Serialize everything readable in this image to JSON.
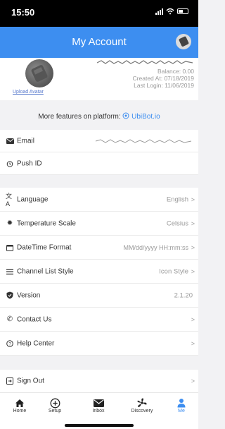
{
  "status_bar": {
    "time": "15:50"
  },
  "header": {
    "title": "My Account"
  },
  "profile": {
    "upload_label": "Upload Avatar",
    "balance_label": "Balance:",
    "balance_value": "0.00",
    "created_label": "Created At:",
    "created_value": "07/18/2019",
    "last_login_label": "Last Login:",
    "last_login_value": "11/06/2019"
  },
  "features": {
    "text": "More features on platform:",
    "link": "UbiBot.io"
  },
  "rows": {
    "email": {
      "label": "Email"
    },
    "push_id": {
      "label": "Push ID"
    },
    "language": {
      "label": "Language",
      "value": "English"
    },
    "temperature": {
      "label": "Temperature Scale",
      "value": "Celsius"
    },
    "datetime": {
      "label": "DateTime Format",
      "value": "MM/dd/yyyy HH:mm:ss"
    },
    "channel": {
      "label": "Channel List Style",
      "value": "Icon Style"
    },
    "version": {
      "label": "Version",
      "value": "2.1.20"
    },
    "contact": {
      "label": "Contact Us"
    },
    "help": {
      "label": "Help Center"
    },
    "signout": {
      "label": "Sign Out"
    }
  },
  "chevron": ">",
  "tabs": [
    {
      "label": "Home",
      "icon": "home-icon"
    },
    {
      "label": "Setup",
      "icon": "plus-circle-icon"
    },
    {
      "label": "Inbox",
      "icon": "mail-icon"
    },
    {
      "label": "Discovery",
      "icon": "fan-icon"
    },
    {
      "label": "Me",
      "icon": "person-icon"
    }
  ],
  "colors": {
    "accent": "#3d8ef0",
    "status_bar": "#000000"
  }
}
